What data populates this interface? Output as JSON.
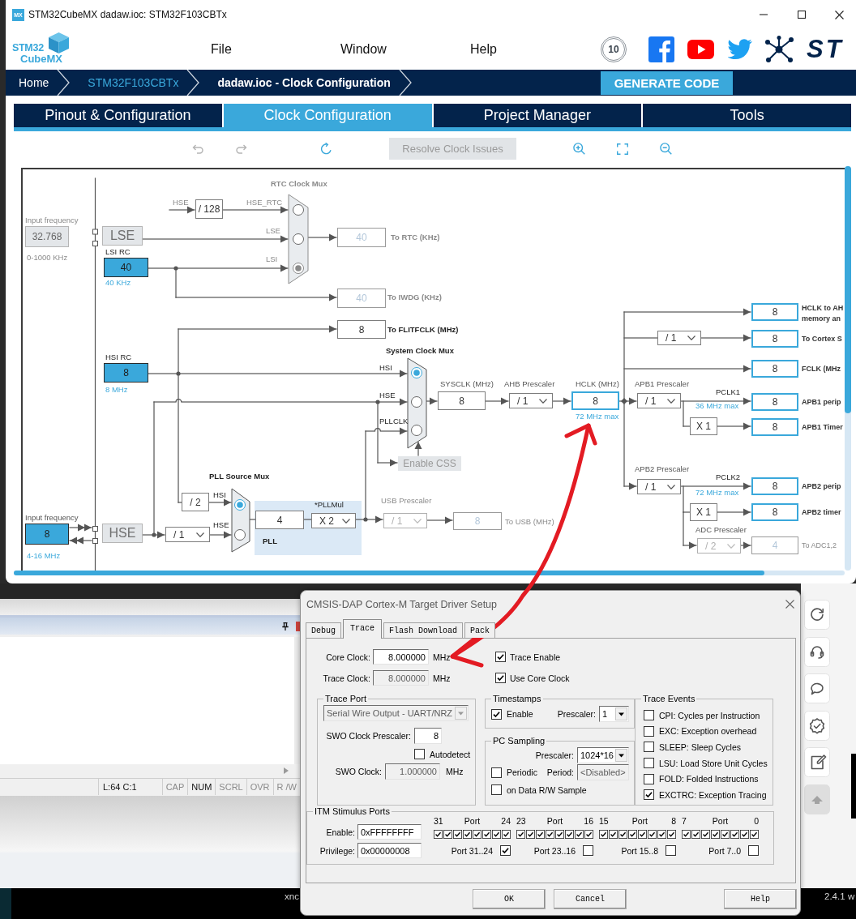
{
  "cubemx_window": {
    "title": "STM32CubeMX dadaw.ioc: STM32F103CBTx",
    "app_icon": "MX",
    "logo": {
      "line_1": "STM32",
      "line_2": "CubeMX"
    },
    "menu": [
      "File",
      "Window",
      "Help"
    ],
    "anniversary_badge": "10",
    "brand_mark": "ST",
    "breadcrumbs": [
      {
        "label": "Home",
        "kind": "home"
      },
      {
        "label": "STM32F103CBTx",
        "kind": "link"
      },
      {
        "label": "dadaw.ioc - Clock Configuration",
        "kind": "current"
      }
    ],
    "generate_button": "GENERATE CODE",
    "tabs": [
      {
        "label": "Pinout & Configuration",
        "selected": false
      },
      {
        "label": "Clock Configuration",
        "selected": true
      },
      {
        "label": "Project Manager",
        "selected": false
      },
      {
        "label": "Tools",
        "selected": false
      }
    ],
    "toolbar": {
      "history": [
        {
          "disabled": true
        },
        {
          "disabled": true
        },
        {
          "disabled": false
        }
      ],
      "resolve_button": {
        "label": "Resolve Clock Issues",
        "disabled": true
      },
      "zoom": [
        {
          "disabled": false
        },
        {
          "disabled": false
        },
        {
          "disabled": false
        }
      ]
    },
    "clock_diagram": {
      "lse_input": {
        "label": "Input frequency",
        "value": "32.768",
        "range": "0-1000 KHz",
        "disabled": true
      },
      "lse_source": "LSE",
      "lsi": {
        "label": "LSI RC",
        "value": "40",
        "note": "40 KHz"
      },
      "hse_rtc_divider": {
        "input": "HSE",
        "value": "/ 128"
      },
      "rtc_mux": {
        "title": "RTC Clock Mux",
        "disabled": true,
        "inputs": [
          {
            "label": "HSE_RTC",
            "selected": false
          },
          {
            "label": "LSE",
            "selected": false
          },
          {
            "label": "LSI",
            "selected": true
          }
        ]
      },
      "rtc_output": {
        "value": "40",
        "label": "To RTC (KHz)",
        "disabled": true
      },
      "iwdg_output": {
        "value": "40",
        "label": "To IWDG (KHz)",
        "disabled": true
      },
      "flitf_output": {
        "value": "8",
        "label": "To FLITFCLK (MHz)",
        "disabled": false
      },
      "hsi": {
        "label": "HSI RC",
        "value": "8",
        "note": "8 MHz"
      },
      "system_mux": {
        "title": "System Clock Mux",
        "disabled": false,
        "inputs": [
          {
            "label": "HSI",
            "selected": true
          },
          {
            "label": "HSE",
            "selected": false
          },
          {
            "label": "PLLCLK",
            "selected": false
          }
        ]
      },
      "css_button": {
        "label": "Enable CSS",
        "disabled": true
      },
      "pll_mux": {
        "title": "PLL Source Mux",
        "disabled": false,
        "inputs": [
          {
            "label": "HSI",
            "selected": true
          },
          {
            "label": "HSE",
            "selected": false
          }
        ]
      },
      "hsi_divider": "/ 2",
      "hse_input": {
        "label": "Input frequency",
        "value": "8",
        "range": "4-16 MHz",
        "disabled": false
      },
      "hse_source": "HSE",
      "hse_prediv": "/ 1",
      "pll": {
        "multiplier_label": "*PLLMul",
        "value": "4",
        "multiplier": "X 2",
        "label": "PLL"
      },
      "usb": {
        "label": "USB Prescaler",
        "prescaler": "/ 1",
        "value": "8",
        "output_label": "To USB (MHz)",
        "disabled": true
      },
      "sysclk": {
        "label": "SYSCLK (MHz)",
        "value": "8"
      },
      "ahb": {
        "label": "AHB Prescaler",
        "value": "/ 1"
      },
      "hclk": {
        "label": "HCLK (MHz)",
        "value": "8",
        "max": "72 MHz max"
      },
      "cortex_divider": "/ 1",
      "apb1": {
        "label": "APB1 Prescaler",
        "value": "/ 1",
        "pclk": "PCLK1",
        "max": "36 MHz max",
        "timer_multiplier": "X 1"
      },
      "apb2": {
        "label": "APB2 Prescaler",
        "value": "/ 1",
        "pclk": "PCLK2",
        "max": "72 MHz max",
        "timer_multiplier": "X 1"
      },
      "adc": {
        "label": "ADC Prescaler",
        "value": "/ 2",
        "disabled": true
      },
      "outputs": [
        {
          "value": "8",
          "label_lines": [
            "HCLK to AH",
            "memory an"
          ],
          "disabled": false
        },
        {
          "value": "8",
          "label_lines": [
            "To Cortex S"
          ],
          "disabled": false
        },
        {
          "value": "8",
          "label_lines": [
            "FCLK (MHz"
          ],
          "disabled": false
        },
        {
          "value": "8",
          "label_lines": [
            "APB1 perip"
          ],
          "disabled": false
        },
        {
          "value": "8",
          "label_lines": [
            "APB1 Timer"
          ],
          "disabled": false
        },
        {
          "value": "8",
          "label_lines": [
            "APB2 perip"
          ],
          "disabled": false
        },
        {
          "value": "8",
          "label_lines": [
            "APB2 timer"
          ],
          "disabled": false
        },
        {
          "value": "4",
          "label_lines": [
            "To ADC1,2"
          ],
          "disabled": true
        }
      ]
    }
  },
  "ide_window": {
    "status_bar": {
      "position": "L:64 C:1",
      "indicators": [
        {
          "label": "CAP",
          "active": false
        },
        {
          "label": "NUM",
          "active": true
        },
        {
          "label": "SCRL",
          "active": false
        },
        {
          "label": "OVR",
          "active": false
        },
        {
          "label": "R /W",
          "active": false
        }
      ]
    }
  },
  "dialog": {
    "title": "CMSIS-DAP Cortex-M Target Driver Setup",
    "tabs": [
      {
        "label": "Debug",
        "selected": false
      },
      {
        "label": "Trace",
        "selected": true
      },
      {
        "label": "Flash Download",
        "selected": false
      },
      {
        "label": "Pack",
        "selected": false
      }
    ],
    "core_clock": {
      "label": "Core Clock:",
      "value": "8.000000",
      "unit": "MHz",
      "disabled": false
    },
    "trace_clock": {
      "label": "Trace Clock:",
      "value": "8.000000",
      "unit": "MHz",
      "disabled": true
    },
    "trace_enable": {
      "label": "Trace Enable",
      "checked": true
    },
    "use_core_clock": {
      "label": "Use Core Clock",
      "checked": true
    },
    "trace_port": {
      "title": "Trace Port",
      "mode": {
        "value": "Serial Wire Output - UART/NRZ",
        "disabled": true
      },
      "swo_prescaler": {
        "label": "SWO Clock Prescaler:",
        "value": "8"
      },
      "autodetect": {
        "label": "Autodetect",
        "checked": false
      },
      "swo_clock": {
        "label": "SWO Clock:",
        "value": "1.000000",
        "unit": "MHz",
        "disabled": true
      }
    },
    "timestamps": {
      "title": "Timestamps",
      "enable": {
        "label": "Enable",
        "checked": true
      },
      "prescaler": {
        "label": "Prescaler:",
        "value": "1"
      }
    },
    "pc_sampling": {
      "title": "PC Sampling",
      "prescaler": {
        "label": "Prescaler:",
        "value": "1024*16"
      },
      "periodic": {
        "label": "Periodic",
        "checked": false
      },
      "period": {
        "label": "Period:",
        "value": "<Disabled>",
        "disabled": true
      },
      "data_sample": {
        "label": "on Data R/W Sample",
        "checked": false
      }
    },
    "trace_events": {
      "title": "Trace Events",
      "items": [
        {
          "label": "CPI: Cycles per Instruction",
          "checked": false
        },
        {
          "label": "EXC: Exception overhead",
          "checked": false
        },
        {
          "label": "SLEEP: Sleep Cycles",
          "checked": false
        },
        {
          "label": "LSU: Load Store Unit Cycles",
          "checked": false
        },
        {
          "label": "FOLD: Folded Instructions",
          "checked": false
        },
        {
          "label": "EXCTRC: Exception Tracing",
          "checked": true
        }
      ]
    },
    "itm": {
      "title": "ITM Stimulus Ports",
      "enable": {
        "label": "Enable:",
        "value": "0xFFFFFFFF"
      },
      "privilege": {
        "label": "Privilege:",
        "value": "0x00000008"
      },
      "groups": [
        {
          "high": "31",
          "port": "Port",
          "low": "24",
          "ports": [
            {
              "checked": true
            },
            {
              "checked": true
            },
            {
              "checked": true
            },
            {
              "checked": true
            },
            {
              "checked": true
            },
            {
              "checked": true
            },
            {
              "checked": true
            },
            {
              "checked": true
            }
          ],
          "privilege_label": "Port 31..24",
          "privileged": true
        },
        {
          "high": "23",
          "port": "Port",
          "low": "16",
          "ports": [
            {
              "checked": true
            },
            {
              "checked": true
            },
            {
              "checked": true
            },
            {
              "checked": true
            },
            {
              "checked": true
            },
            {
              "checked": true
            },
            {
              "checked": true
            },
            {
              "checked": true
            }
          ],
          "privilege_label": "Port 23..16",
          "privileged": false
        },
        {
          "high": "15",
          "port": "Port",
          "low": "8",
          "ports": [
            {
              "checked": true
            },
            {
              "checked": true
            },
            {
              "checked": true
            },
            {
              "checked": true
            },
            {
              "checked": true
            },
            {
              "checked": true
            },
            {
              "checked": true
            },
            {
              "checked": true
            }
          ],
          "privilege_label": "Port 15..8",
          "privileged": false
        },
        {
          "high": "7",
          "port": "Port",
          "low": "0",
          "ports": [
            {
              "checked": true
            },
            {
              "checked": true
            },
            {
              "checked": true
            },
            {
              "checked": true
            },
            {
              "checked": true
            },
            {
              "checked": true
            },
            {
              "checked": true
            },
            {
              "checked": true
            }
          ],
          "privilege_label": "Port 7..0",
          "privileged": false
        }
      ]
    },
    "buttons": [
      "OK",
      "Cancel",
      "Help"
    ]
  },
  "taskbar": {
    "labels": [
      "xnc",
      "2.4.1",
      "w"
    ]
  }
}
